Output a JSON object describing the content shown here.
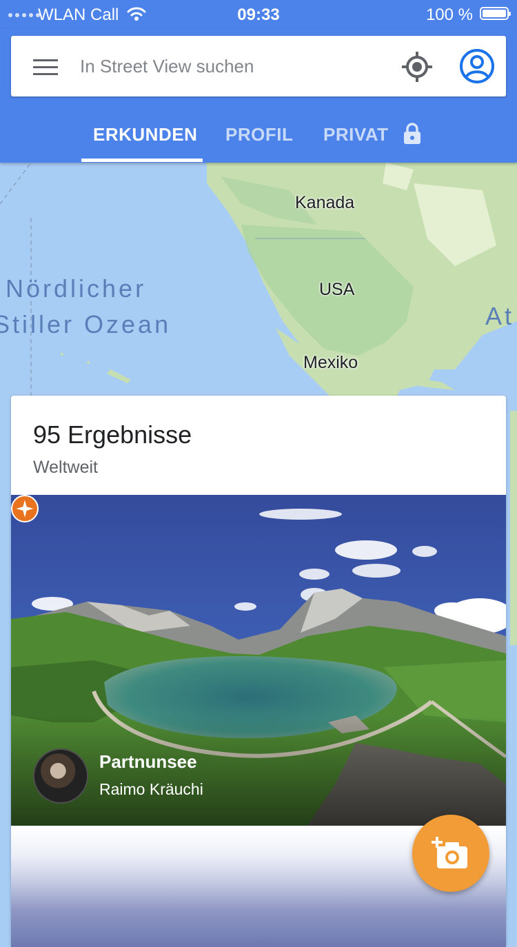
{
  "status_bar": {
    "carrier": "WLAN Call",
    "time": "09:33",
    "battery": "100 %"
  },
  "search": {
    "placeholder": "In Street View suchen"
  },
  "tabs": [
    {
      "label": "ERKUNDEN",
      "active": true
    },
    {
      "label": "PROFIL",
      "active": false
    },
    {
      "label": "PRIVAT",
      "active": false
    }
  ],
  "map": {
    "labels": {
      "canada": "Kanada",
      "usa": "USA",
      "mexico": "Mexiko",
      "ocean_line1": "Nördlicher",
      "ocean_line2": "Stiller Ozean",
      "atlantic_partial": "At"
    }
  },
  "results": {
    "count": "95 Ergebnisse",
    "scope": "Weltweit",
    "items": [
      {
        "title": "Partnunsee",
        "author": "Raimo Kräuchi"
      }
    ]
  },
  "colors": {
    "header": "#4c83ea",
    "fab": "#f29c38",
    "badge": "#e8731e"
  },
  "icons": {
    "menu": "menu-icon",
    "locate": "my-location-icon",
    "account": "account-circle-icon",
    "lock": "lock-icon",
    "add_photo": "add-photo-camera-icon"
  }
}
